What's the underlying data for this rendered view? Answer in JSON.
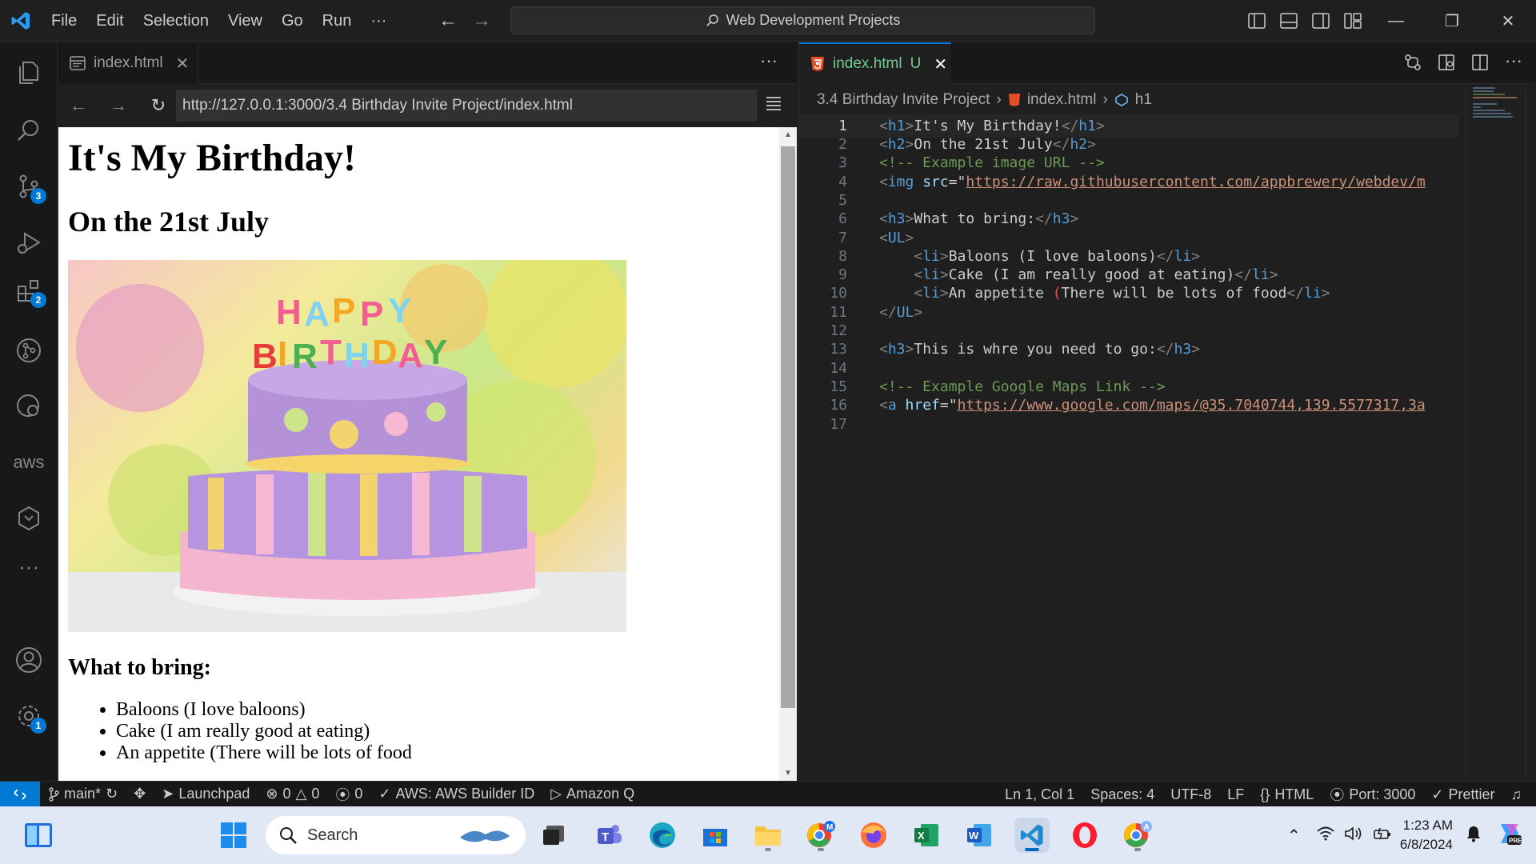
{
  "titlebar": {
    "menu": [
      "File",
      "Edit",
      "Selection",
      "View",
      "Go",
      "Run",
      "···"
    ],
    "search_text": "Web Development Projects"
  },
  "activity": {
    "scm_badge": "3",
    "extensions_badge": "2",
    "aws_label": "aws",
    "more": "···",
    "settings_badge": "1"
  },
  "left_group": {
    "tab_label": "index.html",
    "more": "···",
    "url": "http://127.0.0.1:3000/3.4 Birthday Invite Project/index.html",
    "page": {
      "h1": "It's My Birthday!",
      "h2": "On the 21st July",
      "cake_text": "HAPPY BIRTHDAY",
      "h3": "What to bring:",
      "items": [
        "Baloons (I love baloons)",
        "Cake (I am really good at eating)",
        "An appetite (There will be lots of food"
      ]
    }
  },
  "right_group": {
    "tab_label": "index.html",
    "tab_status": "U",
    "breadcrumb": [
      "3.4 Birthday Invite Project",
      "index.html",
      "h1"
    ],
    "lines": [
      {
        "n": "1",
        "parts": [
          [
            "t-tag",
            "<"
          ],
          [
            "t-name",
            "h1"
          ],
          [
            "t-tag",
            ">"
          ],
          [
            "t-txt",
            "It's My Birthday!"
          ],
          [
            "t-tag",
            "</"
          ],
          [
            "t-name",
            "h1"
          ],
          [
            "t-tag",
            ">"
          ]
        ]
      },
      {
        "n": "2",
        "parts": [
          [
            "t-tag",
            "<"
          ],
          [
            "t-name",
            "h2"
          ],
          [
            "t-tag",
            ">"
          ],
          [
            "t-txt",
            "On the 21st July"
          ],
          [
            "t-tag",
            "</"
          ],
          [
            "t-name",
            "h2"
          ],
          [
            "t-tag",
            ">"
          ]
        ]
      },
      {
        "n": "3",
        "parts": [
          [
            "t-com",
            "<!-- Example image URL -->"
          ]
        ]
      },
      {
        "n": "4",
        "parts": [
          [
            "t-tag",
            "<"
          ],
          [
            "t-name",
            "img"
          ],
          [
            "t-txt",
            " "
          ],
          [
            "t-attr",
            "src"
          ],
          [
            "t-txt",
            "=\""
          ],
          [
            "t-str",
            "https://raw.githubusercontent.com/appbrewery/webdev/m"
          ]
        ]
      },
      {
        "n": "5",
        "parts": []
      },
      {
        "n": "6",
        "parts": [
          [
            "t-tag",
            "<"
          ],
          [
            "t-name",
            "h3"
          ],
          [
            "t-tag",
            ">"
          ],
          [
            "t-txt",
            "What to bring:"
          ],
          [
            "t-tag",
            "</"
          ],
          [
            "t-name",
            "h3"
          ],
          [
            "t-tag",
            ">"
          ]
        ]
      },
      {
        "n": "7",
        "parts": [
          [
            "t-tag",
            "<"
          ],
          [
            "t-name",
            "UL"
          ],
          [
            "t-tag",
            ">"
          ]
        ]
      },
      {
        "n": "8",
        "parts": [
          [
            "t-txt",
            "    "
          ],
          [
            "t-tag",
            "<"
          ],
          [
            "t-name",
            "li"
          ],
          [
            "t-tag",
            ">"
          ],
          [
            "t-txt",
            "Baloons (I love baloons)"
          ],
          [
            "t-tag",
            "</"
          ],
          [
            "t-name",
            "li"
          ],
          [
            "t-tag",
            ">"
          ]
        ]
      },
      {
        "n": "9",
        "parts": [
          [
            "t-txt",
            "    "
          ],
          [
            "t-tag",
            "<"
          ],
          [
            "t-name",
            "li"
          ],
          [
            "t-tag",
            ">"
          ],
          [
            "t-txt",
            "Cake (I am really good at eating)"
          ],
          [
            "t-tag",
            "</"
          ],
          [
            "t-name",
            "li"
          ],
          [
            "t-tag",
            ">"
          ]
        ]
      },
      {
        "n": "10",
        "parts": [
          [
            "t-txt",
            "    "
          ],
          [
            "t-tag",
            "<"
          ],
          [
            "t-name",
            "li"
          ],
          [
            "t-tag",
            ">"
          ],
          [
            "t-txt",
            "An appetite "
          ],
          [
            "t-err",
            "("
          ],
          [
            "t-txt",
            "There will be lots of food"
          ],
          [
            "t-tag",
            "</"
          ],
          [
            "t-name",
            "li"
          ],
          [
            "t-tag",
            ">"
          ]
        ]
      },
      {
        "n": "11",
        "parts": [
          [
            "t-tag",
            "</"
          ],
          [
            "t-name",
            "UL"
          ],
          [
            "t-tag",
            ">"
          ]
        ]
      },
      {
        "n": "12",
        "parts": []
      },
      {
        "n": "13",
        "parts": [
          [
            "t-tag",
            "<"
          ],
          [
            "t-name",
            "h3"
          ],
          [
            "t-tag",
            ">"
          ],
          [
            "t-txt",
            "This is whre you need to go:"
          ],
          [
            "t-tag",
            "</"
          ],
          [
            "t-name",
            "h3"
          ],
          [
            "t-tag",
            ">"
          ]
        ]
      },
      {
        "n": "14",
        "parts": []
      },
      {
        "n": "15",
        "parts": [
          [
            "t-com",
            "<!-- Example Google Maps Link -->"
          ]
        ]
      },
      {
        "n": "16",
        "parts": [
          [
            "t-tag",
            "<"
          ],
          [
            "t-name",
            "a"
          ],
          [
            "t-txt",
            " "
          ],
          [
            "t-attr",
            "href"
          ],
          [
            "t-txt",
            "=\""
          ],
          [
            "t-str",
            "https://www.google.com/maps/@35.7040744,139.5577317,3a"
          ]
        ]
      },
      {
        "n": "17",
        "parts": []
      }
    ]
  },
  "statusbar": {
    "branch": "main*",
    "launchpad": "Launchpad",
    "errors": "0",
    "warnings": "0",
    "ports_count": "0",
    "aws": "AWS: AWS Builder ID",
    "amazon_q": "Amazon Q",
    "position": "Ln 1, Col 1",
    "spaces": "Spaces: 4",
    "encoding": "UTF-8",
    "eol": "LF",
    "language": "HTML",
    "port": "Port: 3000",
    "prettier": "Prettier"
  },
  "taskbar": {
    "search_placeholder": "Search",
    "time": "1:23 AM",
    "date": "6/8/2024"
  }
}
